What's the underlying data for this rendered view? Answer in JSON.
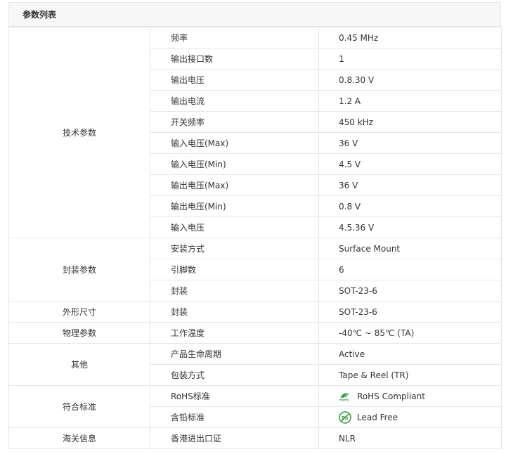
{
  "title": "参数列表",
  "colors": {
    "border": "#e6e6e6",
    "header_bg": "#f7f7f7",
    "text": "#333333",
    "rohs_green": "#2e9a3a"
  },
  "groups": [
    {
      "category": "技术参数",
      "rows": [
        {
          "name": "频率",
          "value": "0.45 MHz"
        },
        {
          "name": "输出接口数",
          "value": "1"
        },
        {
          "name": "输出电压",
          "value": "0.8.30 V"
        },
        {
          "name": "输出电流",
          "value": "1.2 A"
        },
        {
          "name": "开关频率",
          "value": "450 kHz"
        },
        {
          "name": "输入电压(Max)",
          "value": "36 V"
        },
        {
          "name": "输入电压(Min)",
          "value": "4.5 V"
        },
        {
          "name": "输出电压(Max)",
          "value": "36 V"
        },
        {
          "name": "输出电压(Min)",
          "value": "0.8 V"
        },
        {
          "name": "输入电压",
          "value": "4.5.36 V"
        }
      ]
    },
    {
      "category": "封装参数",
      "rows": [
        {
          "name": "安装方式",
          "value": "Surface Mount"
        },
        {
          "name": "引脚数",
          "value": "6"
        },
        {
          "name": "封装",
          "value": "SOT-23-6"
        }
      ]
    },
    {
      "category": "外形尺寸",
      "rows": [
        {
          "name": "封装",
          "value": "SOT-23-6"
        }
      ]
    },
    {
      "category": "物理参数",
      "rows": [
        {
          "name": "工作温度",
          "value": "-40℃ ~ 85℃ (TA)"
        }
      ]
    },
    {
      "category": "其他",
      "rows": [
        {
          "name": "产品生命周期",
          "value": "Active"
        },
        {
          "name": "包装方式",
          "value": "Tape & Reel (TR)"
        }
      ]
    },
    {
      "category": "符合标准",
      "rows": [
        {
          "name": "RoHS标准",
          "value": "RoHS Compliant",
          "icon": "rohs-icon"
        },
        {
          "name": "含铅标准",
          "value": "Lead Free",
          "icon": "lead-free-icon"
        }
      ]
    },
    {
      "category": "海关信息",
      "rows": [
        {
          "name": "香港进出口证",
          "value": "NLR"
        }
      ]
    }
  ]
}
